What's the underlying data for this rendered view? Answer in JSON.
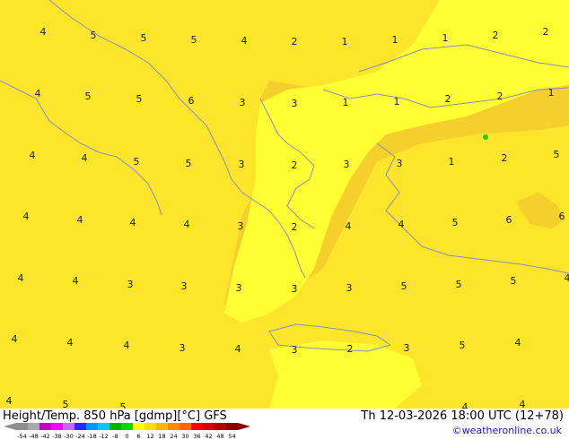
{
  "map": {
    "colors": {
      "fill_light": "#ffff33",
      "fill_mid": "#fce52a",
      "fill_dark": "#f5cf2c",
      "coast": "#8a8fc4",
      "green_dot": "#22cc22"
    },
    "labels": [
      {
        "id": "r1a",
        "text": "4"
      },
      {
        "id": "r1b",
        "text": "5"
      },
      {
        "id": "r1c",
        "text": "5"
      },
      {
        "id": "r1d",
        "text": "5"
      },
      {
        "id": "r1e",
        "text": "4"
      },
      {
        "id": "r1f",
        "text": "2"
      },
      {
        "id": "r1g",
        "text": "1"
      },
      {
        "id": "r1h",
        "text": "1"
      },
      {
        "id": "r1i",
        "text": "1"
      },
      {
        "id": "r1j",
        "text": "2"
      },
      {
        "id": "r1k",
        "text": "2"
      },
      {
        "id": "r2a",
        "text": "4"
      },
      {
        "id": "r2b",
        "text": "5"
      },
      {
        "id": "r2c",
        "text": "5"
      },
      {
        "id": "r2d",
        "text": "6"
      },
      {
        "id": "r2e",
        "text": "3"
      },
      {
        "id": "r2f",
        "text": "3"
      },
      {
        "id": "r2g",
        "text": "1"
      },
      {
        "id": "r2h",
        "text": "1"
      },
      {
        "id": "r2i",
        "text": "2"
      },
      {
        "id": "r2j",
        "text": "2"
      },
      {
        "id": "r2k",
        "text": "1"
      },
      {
        "id": "r3a",
        "text": "4"
      },
      {
        "id": "r3b",
        "text": "4"
      },
      {
        "id": "r3c",
        "text": "5"
      },
      {
        "id": "r3d",
        "text": "5"
      },
      {
        "id": "r3e",
        "text": "3"
      },
      {
        "id": "r3f",
        "text": "2"
      },
      {
        "id": "r3g",
        "text": "3"
      },
      {
        "id": "r3h",
        "text": "3"
      },
      {
        "id": "r3i",
        "text": "1"
      },
      {
        "id": "r3j",
        "text": "2"
      },
      {
        "id": "r3k",
        "text": "5"
      },
      {
        "id": "r4a",
        "text": "4"
      },
      {
        "id": "r4b",
        "text": "4"
      },
      {
        "id": "r4c",
        "text": "4"
      },
      {
        "id": "r4d",
        "text": "4"
      },
      {
        "id": "r4e",
        "text": "3"
      },
      {
        "id": "r4f",
        "text": "2"
      },
      {
        "id": "r4g",
        "text": "4"
      },
      {
        "id": "r4h",
        "text": "4"
      },
      {
        "id": "r4i",
        "text": "5"
      },
      {
        "id": "r4j",
        "text": "6"
      },
      {
        "id": "r4k",
        "text": "6"
      },
      {
        "id": "r5a",
        "text": "4"
      },
      {
        "id": "r5b",
        "text": "4"
      },
      {
        "id": "r5c",
        "text": "3"
      },
      {
        "id": "r5d",
        "text": "3"
      },
      {
        "id": "r5e",
        "text": "3"
      },
      {
        "id": "r5f",
        "text": "3"
      },
      {
        "id": "r5g",
        "text": "3"
      },
      {
        "id": "r5h",
        "text": "5"
      },
      {
        "id": "r5i",
        "text": "5"
      },
      {
        "id": "r5j",
        "text": "5"
      },
      {
        "id": "r5k",
        "text": "4"
      },
      {
        "id": "r6a",
        "text": "4"
      },
      {
        "id": "r6b",
        "text": "4"
      },
      {
        "id": "r6c",
        "text": "4"
      },
      {
        "id": "r6d",
        "text": "3"
      },
      {
        "id": "r6e",
        "text": "4"
      },
      {
        "id": "r6f",
        "text": "3"
      },
      {
        "id": "r6g",
        "text": "2"
      },
      {
        "id": "r6h",
        "text": "3"
      },
      {
        "id": "r6i",
        "text": "5"
      },
      {
        "id": "r6j",
        "text": "4"
      },
      {
        "id": "r7a",
        "text": "4"
      },
      {
        "id": "r7b",
        "text": "5"
      },
      {
        "id": "r7c",
        "text": "5"
      },
      {
        "id": "r7d",
        "text": "4"
      },
      {
        "id": "r7e",
        "text": "4"
      }
    ]
  },
  "footer": {
    "title": "Height/Temp. 850 hPa [gdmp][°C] GFS",
    "datetime": "Th 12-03-2026 18:00 UTC (12+78)",
    "credit": "©weatheronline.co.uk"
  },
  "legend": {
    "ticks": [
      "-54",
      "-48",
      "-42",
      "-38",
      "-30",
      "-24",
      "-18",
      "-12",
      "-8",
      "0",
      "6",
      "12",
      "18",
      "24",
      "30",
      "36",
      "42",
      "48",
      "54"
    ],
    "colors": [
      "#8e8e8e",
      "#a8a8a8",
      "#c800c8",
      "#ff00ff",
      "#c864ff",
      "#2828ff",
      "#0096ff",
      "#00c8ff",
      "#00b400",
      "#00dc00",
      "#ffff00",
      "#ffdc00",
      "#ffb400",
      "#ff8c00",
      "#ff6400",
      "#ff0000",
      "#dc0000",
      "#b40000",
      "#8c0000"
    ]
  }
}
